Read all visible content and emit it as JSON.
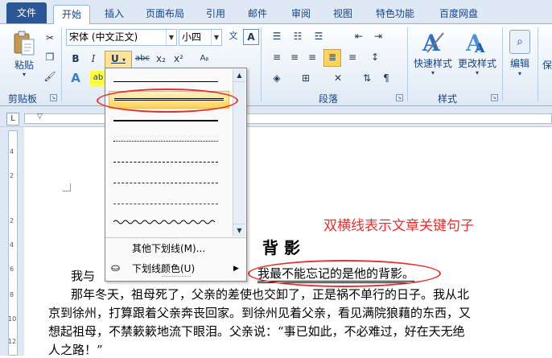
{
  "tabs": [
    "文件",
    "开始",
    "插入",
    "页面布局",
    "引用",
    "邮件",
    "审阅",
    "视图",
    "特色功能",
    "百度网盘"
  ],
  "clipboard": {
    "paste": "粘贴",
    "group": "剪贴板"
  },
  "font": {
    "name": "宋体 (中文正文)",
    "size": "小四"
  },
  "paragraph": {
    "group": "段落"
  },
  "styles": {
    "quick": "快速样式",
    "change": "更改样式",
    "group": "样式"
  },
  "editing": {
    "label": "编辑"
  },
  "ribbon_cut": {
    "text": "保"
  },
  "underline_menu": {
    "more": "其他下划线(M)...",
    "color": "下划线颜色(U)"
  },
  "annotation": "双横线表示文章关键句子",
  "document": {
    "title": "背 影",
    "line1_start": "我与",
    "line1_mark": "我最不能忘记的是他的背影。",
    "para2_1": "那年冬天，祖母死了，父亲的差使也交卸了，正是祸不单行的日子。我从北",
    "para2_2": "京到徐州，打算跟着父亲奔丧回家。到徐州见着父亲，看见满院狼藉的东西，又",
    "para2_3": "想起祖母，不禁簌簌地流下眼泪。父亲说：“事已如此，不必难过，好在天无绝",
    "para2_4": "人之路！”"
  },
  "colors": {
    "accent": "#2b5797",
    "annotation": "#e53030",
    "highlight": "#ffd35c"
  }
}
